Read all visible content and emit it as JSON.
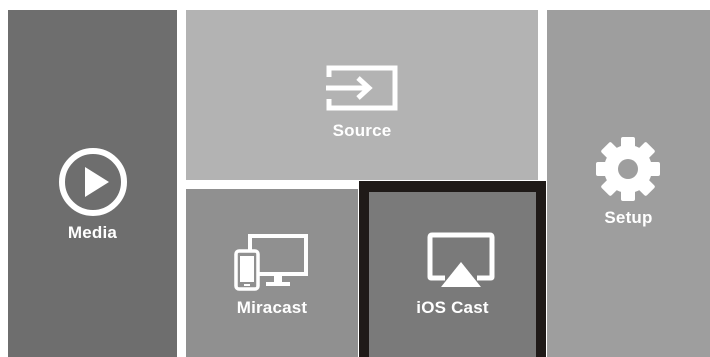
{
  "menu": {
    "media": {
      "label": "Media",
      "icon": "play-circle-icon",
      "color": "#6e6e6e"
    },
    "source": {
      "label": "Source",
      "icon": "input-source-icon",
      "color": "#b3b3b3"
    },
    "setup": {
      "label": "Setup",
      "icon": "gear-icon",
      "color": "#9e9e9e"
    },
    "miracast": {
      "label": "Miracast",
      "icon": "devices-icon",
      "color": "#909090"
    },
    "ios_cast": {
      "label": "iOS Cast",
      "icon": "airplay-icon",
      "color": "#7a7a7a",
      "selected": true,
      "selection_color": "#1f1a18"
    }
  }
}
